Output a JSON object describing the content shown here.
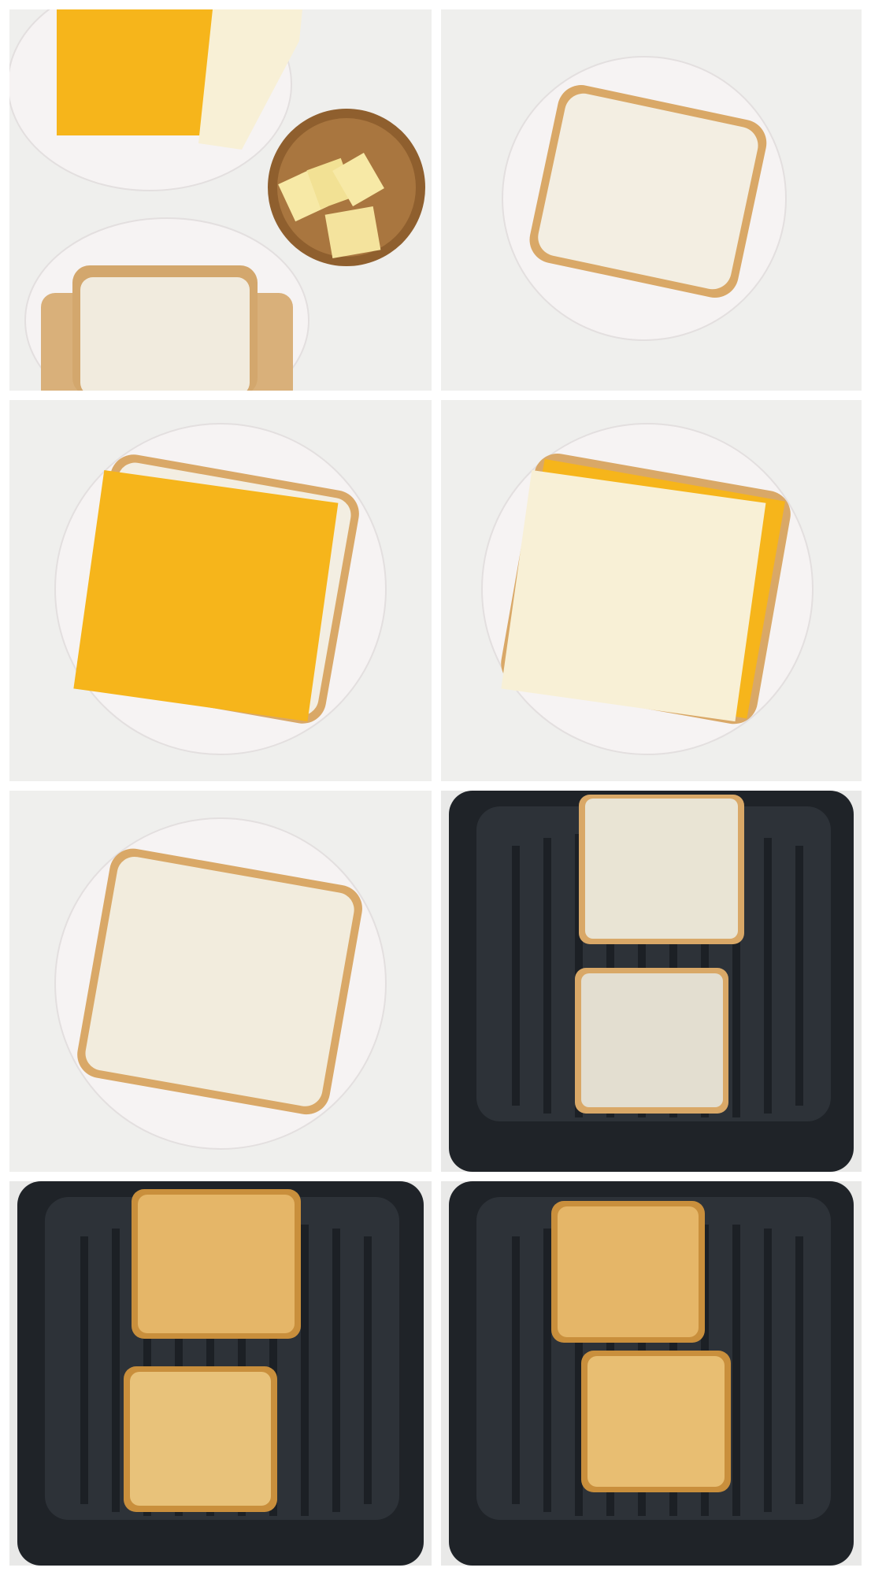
{
  "colors": {
    "background": "#ffffff",
    "counter": "#eeeeec",
    "plate": "#f4f1f1",
    "plate_rim": "#e6e1e1",
    "bread": "#f3eee2",
    "crust": "#d8a866",
    "butter_spread": "#efe9d8",
    "cheddar": "#f6b51b",
    "white_cheese": "#f8f0d6",
    "bowl": "#9a6a36",
    "butter_cube": "#f7e9a6",
    "fryer_basket": "#22262b",
    "fryer_grate": "#2f343b",
    "toast": "#e5b668",
    "toast_dark": "#c98f3c"
  },
  "steps": [
    {
      "subject": "ingredients",
      "icon": "ingredients-icon"
    },
    {
      "subject": "buttered-bread-slice",
      "icon": "bread-icon"
    },
    {
      "subject": "bread-with-cheddar",
      "icon": "cheddar-icon"
    },
    {
      "subject": "bread-with-white-cheese",
      "icon": "cheese-icon"
    },
    {
      "subject": "buttered-top-slice",
      "icon": "bread-icon"
    },
    {
      "subject": "sandwiches-in-air-fryer",
      "icon": "air-fryer-icon"
    },
    {
      "subject": "sandwiches-toasted-side-one",
      "icon": "toast-icon"
    },
    {
      "subject": "sandwiches-toasted-side-two",
      "icon": "toast-icon"
    }
  ]
}
